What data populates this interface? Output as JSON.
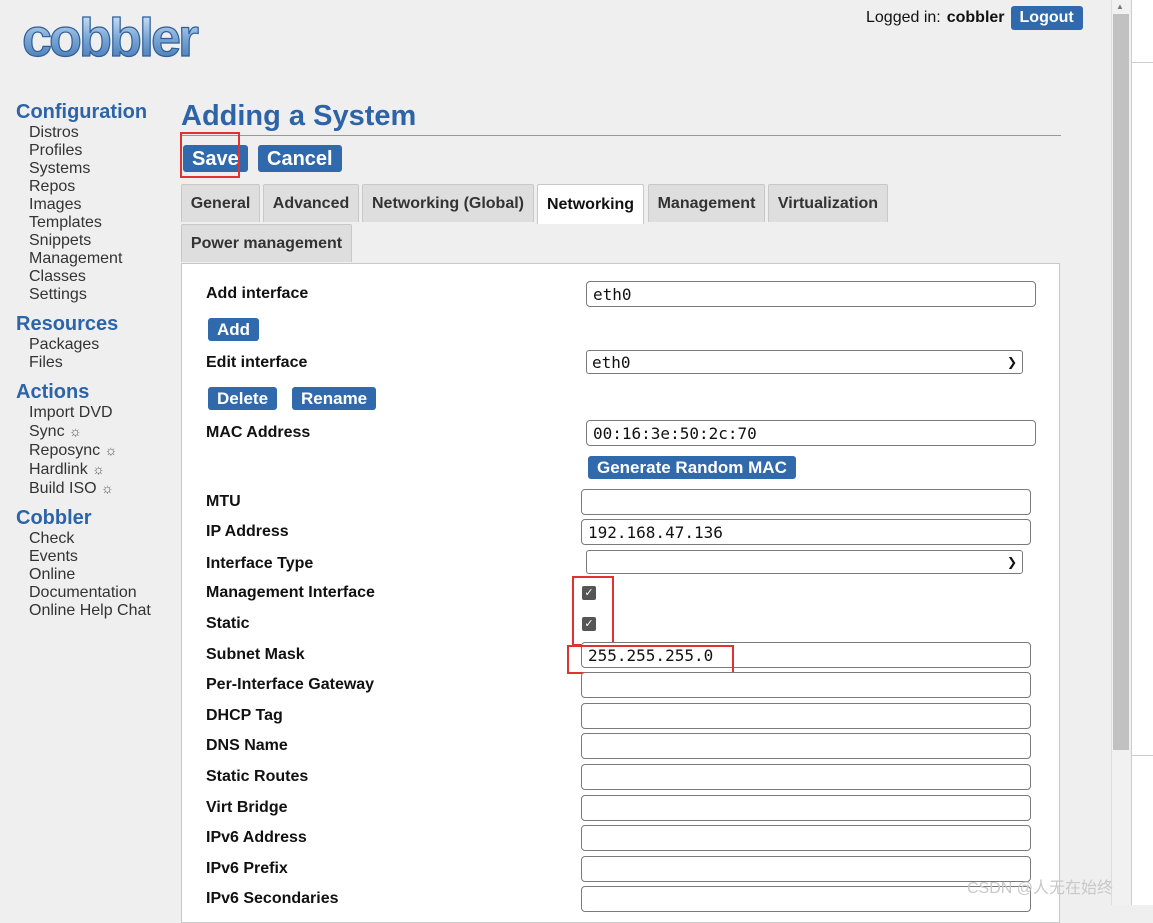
{
  "logo": {
    "text": "cobbler"
  },
  "header": {
    "logged_in_label": "Logged in:",
    "username": "cobbler",
    "logout_label": "Logout"
  },
  "nav": {
    "configuration": {
      "title": "Configuration",
      "items": [
        "Distros",
        "Profiles",
        "Systems",
        "Repos",
        "Images",
        "Templates",
        "Snippets",
        "Management",
        "Classes",
        "Settings"
      ]
    },
    "resources": {
      "title": "Resources",
      "items": [
        "Packages",
        "Files"
      ]
    },
    "actions": {
      "title": "Actions",
      "items": [
        "Import DVD",
        "Sync",
        "Reposync",
        "Hardlink",
        "Build ISO"
      ],
      "spin_icon": "☼"
    },
    "cobbler": {
      "title": "Cobbler",
      "items": [
        "Check",
        "Events",
        "Online",
        "Documentation",
        "Online Help Chat"
      ]
    }
  },
  "page": {
    "title": "Adding a System",
    "save_label": "Save",
    "cancel_label": "Cancel"
  },
  "tabs": [
    "General",
    "Advanced",
    "Networking (Global)",
    "Networking",
    "Management",
    "Virtualization",
    "Power management"
  ],
  "active_tab": "Networking",
  "form": {
    "add_interface_label": "Add interface",
    "add_interface_value": "eth0",
    "add_button": "Add",
    "edit_interface_label": "Edit interface",
    "edit_interface_value": "eth0",
    "delete_button": "Delete",
    "rename_button": "Rename",
    "mac_label": "MAC Address",
    "mac_value": "00:16:3e:50:2c:70",
    "generate_mac_button": "Generate Random MAC",
    "mtu_label": "MTU",
    "mtu_value": "",
    "ip_label": "IP Address",
    "ip_value": "192.168.47.136",
    "interface_type_label": "Interface Type",
    "interface_type_value": "",
    "management_interface_label": "Management Interface",
    "management_interface_checked": true,
    "static_label": "Static",
    "static_checked": true,
    "subnet_label": "Subnet Mask",
    "subnet_value": "255.255.255.0",
    "gateway_label": "Per-Interface Gateway",
    "dhcp_tag_label": "DHCP Tag",
    "dns_name_label": "DNS Name",
    "static_routes_label": "Static Routes",
    "virt_bridge_label": "Virt Bridge",
    "ipv6_address_label": "IPv6 Address",
    "ipv6_prefix_label": "IPv6 Prefix",
    "ipv6_secondaries_label": "IPv6 Secondaries"
  },
  "watermark": "CSDN @人无在始终",
  "colors": {
    "accent": "#3169ad",
    "heading": "#2d64a8",
    "highlight": "#e03232"
  }
}
